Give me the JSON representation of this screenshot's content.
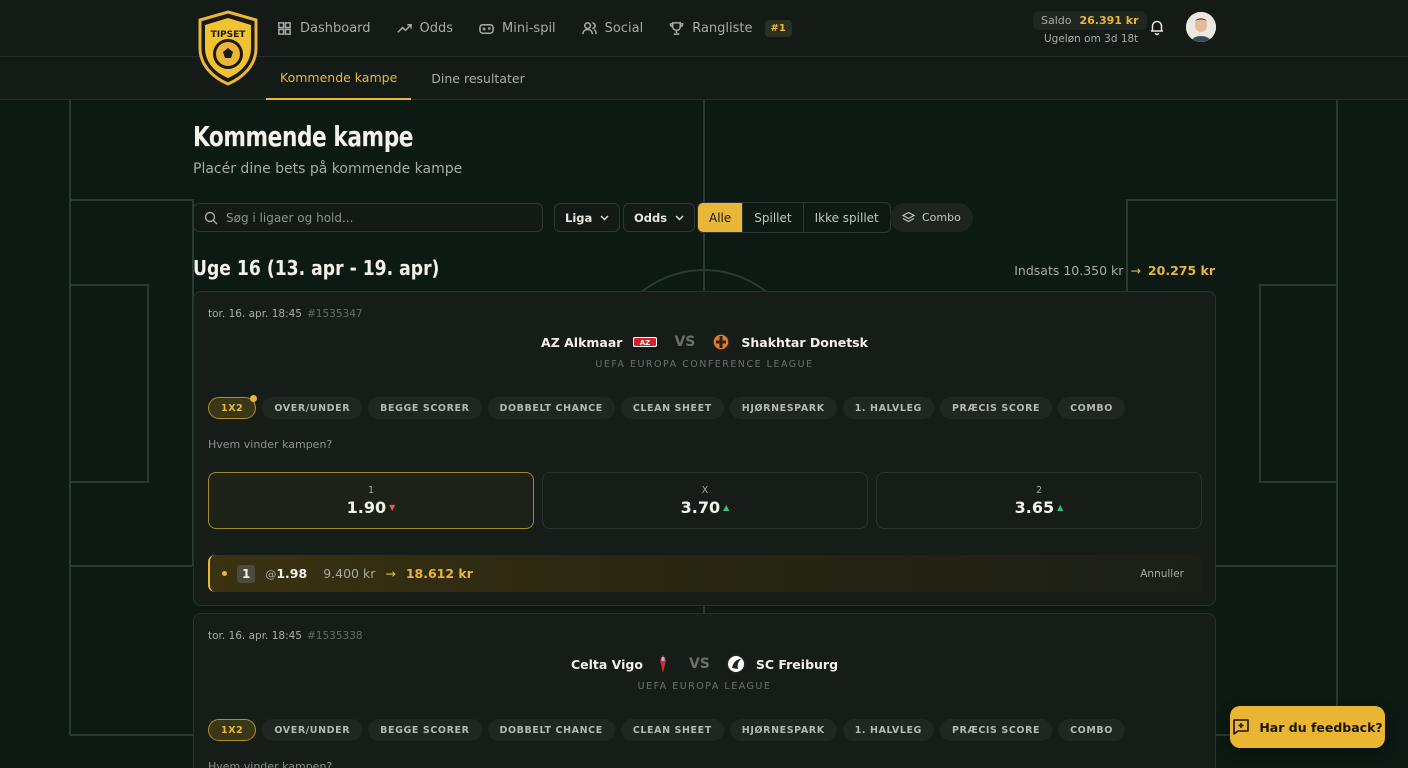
{
  "brand": {
    "logo_text": "TIPSET"
  },
  "nav": {
    "items": [
      {
        "label": "Dashboard",
        "icon": "grid-icon"
      },
      {
        "label": "Odds",
        "icon": "trend-icon"
      },
      {
        "label": "Mini-spil",
        "icon": "gamepad-icon"
      },
      {
        "label": "Social",
        "icon": "users-icon"
      },
      {
        "label": "Rangliste",
        "icon": "trophy-icon"
      }
    ],
    "rank_badge": "#1"
  },
  "account": {
    "saldo_label": "Saldo",
    "saldo_value": "26.391 kr",
    "weekly_reset": "Ugeløn om 3d 18t"
  },
  "subnav": {
    "tabs": [
      "Kommende kampe",
      "Dine resultater"
    ],
    "active": 0
  },
  "page": {
    "title": "Kommende kampe",
    "subtitle": "Placér dine bets på kommende kampe"
  },
  "filters": {
    "search_placeholder": "Søg i ligaer og hold...",
    "league_dropdown": "Liga",
    "odds_dropdown": "Odds",
    "segments": [
      "Alle",
      "Spillet",
      "Ikke spillet"
    ],
    "active_segment": 0,
    "combo_label": "Combo"
  },
  "week": {
    "title": "Uge 16 (13. apr - 19. apr)",
    "stake_label": "Indsats 10.350 kr",
    "arrow": "→",
    "potential": "20.275 kr"
  },
  "markets": [
    "1X2",
    "OVER/UNDER",
    "BEGGE SCORER",
    "DOBBELT CHANCE",
    "CLEAN SHEET",
    "HJØRNESPARK",
    "1. HALVLEG",
    "PRÆCIS SCORE",
    "COMBO"
  ],
  "matches": [
    {
      "datetime": "tor. 16. apr. 18:45",
      "id": "#1535347",
      "home": "AZ Alkmaar",
      "away": "Shakhtar Donetsk",
      "vs": "VS",
      "league": "UEFA EUROPA CONFERENCE LEAGUE",
      "question": "Hvem vinder kampen?",
      "odds": [
        {
          "label": "1",
          "value": "1.90",
          "trend": "down"
        },
        {
          "label": "X",
          "value": "3.70",
          "trend": "up"
        },
        {
          "label": "2",
          "value": "3.65",
          "trend": "up"
        }
      ],
      "bet": {
        "selection": "1",
        "at": "@",
        "odds": "1.98",
        "stake": "9.400 kr",
        "arrow": "→",
        "win": "18.612 kr",
        "cancel": "Annuller"
      }
    },
    {
      "datetime": "tor. 16. apr. 18:45",
      "id": "#1535338",
      "home": "Celta Vigo",
      "away": "SC Freiburg",
      "vs": "VS",
      "league": "UEFA EUROPA LEAGUE",
      "question": "Hvem vinder kampen?"
    }
  ],
  "feedback": {
    "label": "Har du feedback?"
  },
  "colors": {
    "accent": "#e8b73a",
    "background": "#0c1a13",
    "card": "#161d19",
    "up": "#35c17f",
    "down": "#e05b4b"
  }
}
